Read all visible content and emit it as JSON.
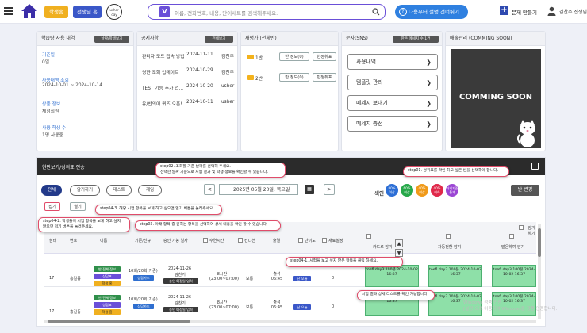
{
  "header": {
    "student_home": "학생홈",
    "teacher_home": "선생님 홈",
    "avatar_text": "usher day",
    "search_logo": "V",
    "search_placeholder": "이름, 전화번호, 내용, 단어세트를 검색해주세요.",
    "guide_button": "다용부터 설명 건너뛰기",
    "make_problem": "문제 만들기",
    "user_name": "김찬주 선생님"
  },
  "learning": {
    "title": "학습량 사용 내역",
    "button": "날짜/학생보기",
    "base_label": "기준일",
    "base_value": "0일",
    "period_label": "사용내역 조회",
    "period_value": "2024-10-01 ~ 2024-10-14",
    "product_label": "상품 정보",
    "product_value": "체험회원",
    "student_label": "사용 학생 수",
    "student_value": "1명 사용중"
  },
  "notice": {
    "title": "공지사항",
    "button": "전체보기",
    "rows": [
      {
        "title": "관리자 모드 접속 방법",
        "date": "2024-11-11",
        "author": "김찬주"
      },
      {
        "title": "영한 조회 업데이트",
        "date": "2024-10-29",
        "author": "김찬주"
      },
      {
        "title": "TEST 기능 추가 업...",
        "date": "2024-10-20",
        "author": "usher"
      },
      {
        "title": "유/반의어 퀴즈 오픈!",
        "date": "2024-10-11",
        "author": "usher"
      }
    ]
  },
  "reexam": {
    "title": "재평가 (전체반)",
    "rows": [
      {
        "label": "1반",
        "btn1": "반 정보(0)",
        "btn2": "반정취표"
      },
      {
        "label": "2반",
        "btn1": "반 정보(0)",
        "btn2": "반정취표"
      }
    ]
  },
  "sms": {
    "title": "문자(SNS)",
    "button": "잔은 메세지 수 1건",
    "menus": [
      "사용내역",
      "템플릿 관리",
      "메세지 보내기",
      "메세지 충전"
    ]
  },
  "sales": {
    "title": "매출관리 (COMMING SOON)",
    "banner": "COMMING SOON"
  },
  "panel": {
    "title": "현판보기/성취표 전송",
    "tabs": [
      "전체",
      "암기하기",
      "테스트",
      "게임"
    ],
    "small_tabs": [
      "접기",
      "열기"
    ],
    "date": "2025년 05월 20일, 목요일",
    "legend_label": "색인",
    "legend": [
      {
        "top": "80%",
        "bottom": "이상",
        "color": "#2d6fd6"
      },
      {
        "top": "60%",
        "bottom": "이상",
        "color": "#27a84a"
      },
      {
        "top": "40%",
        "bottom": "이상",
        "color": "#f09a1a"
      },
      {
        "top": "40%",
        "bottom": "이하",
        "color": "#e0294a"
      },
      {
        "top": "자기기준",
        "bottom": "통과",
        "color": "#9b46d4"
      }
    ],
    "class_change": "반 변경",
    "memorize_label": "암기하기",
    "headers": [
      "삼태",
      "번호",
      "이름",
      "기존/신규",
      "승인 기능 일자",
      "수연시간",
      "컨디션",
      "출결",
      "난이도",
      "재료설정"
    ],
    "sub_headers": [
      "카드로 암기",
      "자동전환 암기",
      "발음하여 암기"
    ],
    "rows": [
      {
        "state": "17",
        "num": "홍길동",
        "tags": [
          "반 전체 정보",
          "상담표",
          "학생 홈"
        ],
        "type": "10회/20회(기존)",
        "type_tag": "상담카드",
        "date": "2024-11-26",
        "date_sub": "김찬기",
        "date_tag": "승인 예정일 입력",
        "time": "8시간 (23:00~07:00)",
        "cond": "보통",
        "att": "출석 06:45",
        "diff_tag": "난 오늘",
        "mat": "0",
        "cards": [
          "toefl day3 100분 2024-10-02 16:37",
          "toefl day3 100분 2024-10-02 16:37",
          "toefl day3 100분 2024-10-02 16:37"
        ]
      },
      {
        "state": "17",
        "num": "홍길동",
        "tags": [
          "반 전체 정보",
          "상담표",
          "학생 홈"
        ],
        "type": "10회/20회(기존)",
        "type_tag": "상담카드",
        "date": "2024-11-26",
        "date_sub": "김찬기",
        "date_tag": "승인 예정일 입력",
        "time": "8시간 (23:00~07:00)",
        "cond": "보통",
        "att": "출석 06:45",
        "diff_tag": "난 오늘",
        "mat": "0",
        "cards": [
          "toefl day3 100분 2024-10-02 16:37",
          "toefl day3 100분 2024-10-02 16:37",
          "toefl day3 100분 2024-10-02 16:37"
        ]
      }
    ]
  },
  "tips": {
    "step02": "step02. 조회할 기준 날짜를 선택해 주세요.\n선택한 날짜 기준으로 시험 결과 및 학생 정보를 확인할 수 있습니다.",
    "step01": "step01. 성취표를 확인 하고 싶은 반을 선택해야 합니다.",
    "step043": "step04-3. 해당 시험 항목을 보게 하고 싶으면 열기 버튼을 눌러주세요.",
    "step03": "step03. 아래 항목 중 원하는 항목을 선택하여 상세 내용을 확인 할 수 있습니다.",
    "step042": "step04-2. 학생들이 시험 항목을 보게 하고 싶지\n않으면 접기 버튼을 눌러주세요.",
    "step041": "step04-1. 시험을 보고 싶지 않은 항목을 클릭 하세요.",
    "detail": "시험 결과 상세 리스트를 확인 가능합니다."
  },
  "watermark": "Windows 정품 인증\n[설정]으로 이동하여 Windows를 정품 인증합니다."
}
